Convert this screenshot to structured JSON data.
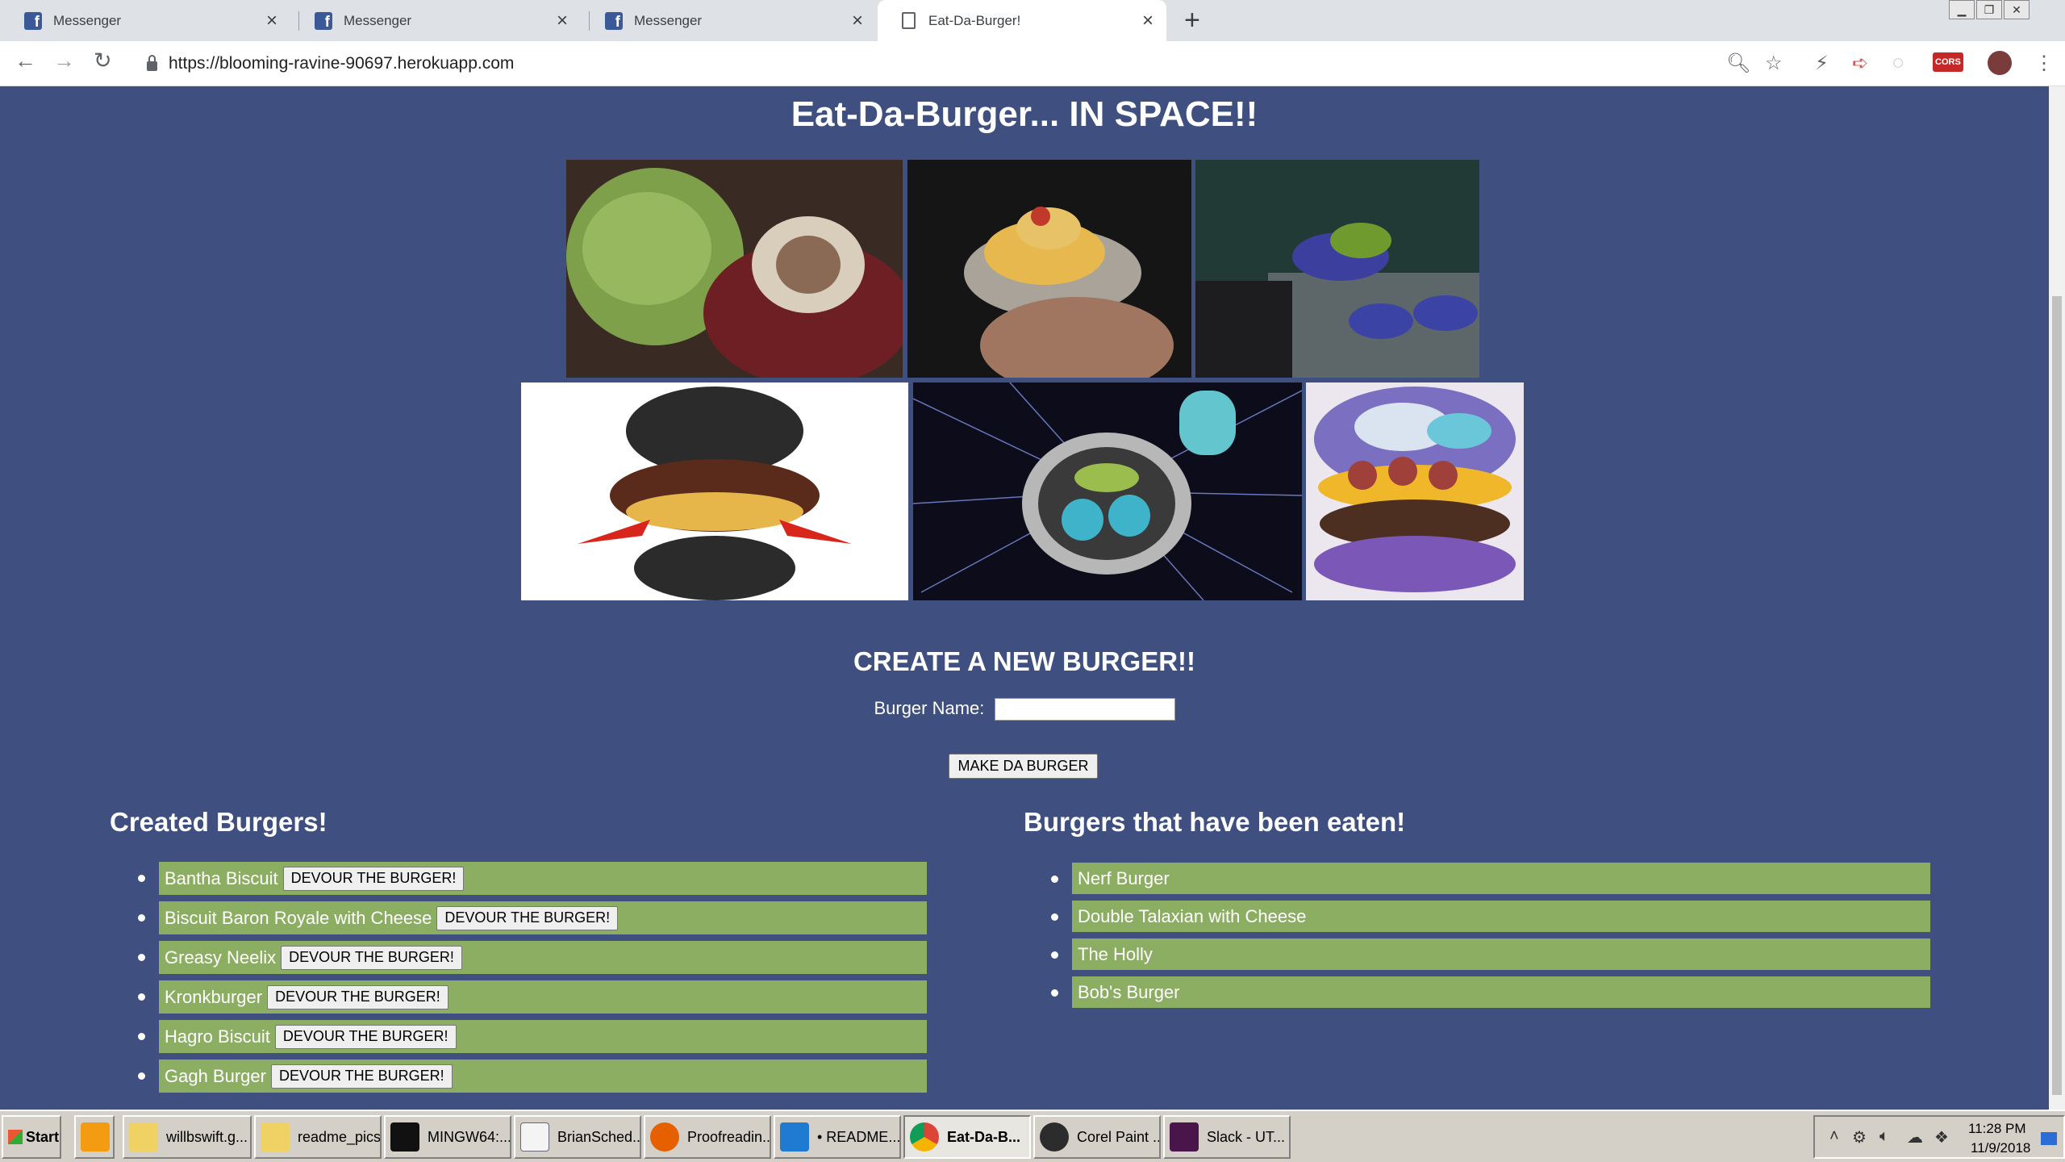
{
  "browser": {
    "tabs": [
      {
        "title": "Messenger",
        "icon": "facebook-icon",
        "active": false
      },
      {
        "title": "Messenger",
        "icon": "facebook-icon",
        "active": false
      },
      {
        "title": "Messenger",
        "icon": "facebook-icon",
        "active": false
      },
      {
        "title": "Eat-Da-Burger!",
        "icon": "page-icon",
        "active": true
      }
    ],
    "new_tab_label": "+",
    "url": "https://blooming-ravine-90697.herokuapp.com",
    "extension_badge": "CORS"
  },
  "page": {
    "title": "Eat-Da-Burger... IN SPACE!!",
    "create_heading": "CREATE A NEW BURGER!!",
    "burger_name_label": "Burger Name:",
    "burger_name_value": "",
    "make_button": "MAKE DA BURGER",
    "created_heading": "Created Burgers!",
    "eaten_heading": "Burgers that have been eaten!",
    "created_burgers": [
      {
        "name": "Bantha Biscuit",
        "button": "DEVOUR THE BURGER!"
      },
      {
        "name": "Biscuit Baron Royale with Cheese",
        "button": "DEVOUR THE BURGER!"
      },
      {
        "name": "Greasy Neelix",
        "button": "DEVOUR THE BURGER!"
      },
      {
        "name": "Kronkburger",
        "button": "DEVOUR THE BURGER!"
      },
      {
        "name": "Hagro Biscuit",
        "button": "DEVOUR THE BURGER!"
      },
      {
        "name": "Gagh Burger",
        "button": "DEVOUR THE BURGER!"
      }
    ],
    "eaten_burgers": [
      {
        "name": "Nerf Burger"
      },
      {
        "name": "Double Talaxian with Cheese"
      },
      {
        "name": "The Holly"
      },
      {
        "name": "Bob's Burger"
      }
    ]
  },
  "taskbar": {
    "start": "Start",
    "items": [
      {
        "label": "willbswift.g...",
        "icon": "folder-icon"
      },
      {
        "label": "readme_pics",
        "icon": "folder-icon"
      },
      {
        "label": "MINGW64:...",
        "icon": "terminal-icon"
      },
      {
        "label": "BrianSched...",
        "icon": "word-document-icon"
      },
      {
        "label": "Proofreadin...",
        "icon": "firefox-icon"
      },
      {
        "label": "• README...",
        "icon": "vscode-icon"
      },
      {
        "label": "Eat-Da-B...",
        "icon": "chrome-icon",
        "active": true
      },
      {
        "label": "Corel Paint ...",
        "icon": "corel-paint-icon"
      },
      {
        "label": "Slack - UT...",
        "icon": "slack-icon"
      }
    ],
    "clock_time": "11:28 PM",
    "clock_date": "11/9/2018"
  },
  "colors": {
    "page_background": "#3e4f80",
    "list_item_background": "#8cae62",
    "text": "#ffffff"
  }
}
